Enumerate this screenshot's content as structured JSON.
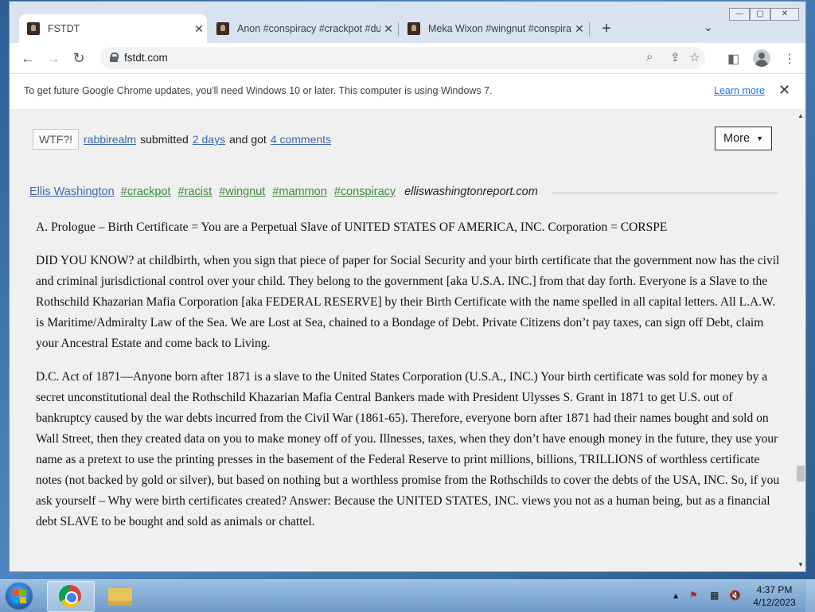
{
  "browser": {
    "tabs": [
      {
        "title": "FSTDT",
        "active": true
      },
      {
        "title": "Anon #conspiracy #crackpot #du",
        "active": false
      },
      {
        "title": "Meka Wixon #wingnut #conspira",
        "active": false
      }
    ],
    "new_tab_icon": "+",
    "tab_search_icon": "⌄",
    "window_controls": {
      "minimize": "—",
      "maximize": "▢",
      "close": "✕"
    },
    "url": "fstdt.com",
    "infobar": {
      "message": "To get future Google Chrome updates, you'll need Windows 10 or later. This computer is using Windows 7.",
      "learn_more": "Learn more",
      "close": "✕"
    }
  },
  "post_meta": {
    "badge": "WTF?!",
    "user": "rabbirealm",
    "submitted": "submitted",
    "time": "2 days",
    "and_got": "and got",
    "comments": "4 comments",
    "more_button": "More",
    "more_caret": "▼"
  },
  "quote": {
    "author": "Ellis Washington",
    "tags": [
      "#crackpot",
      "#racist",
      "#wingnut",
      "#mammon",
      "#conspiracy"
    ],
    "source": "elliswashingtonreport.com",
    "paragraphs": [
      "A. Prologue – Birth Certificate = You are a Perpetual Slave of UNITED STATES OF AMERICA, INC. Corporation = CORSPE",
      "DID YOU KNOW? at childbirth, when you sign that piece of paper for Social Security and your birth certificate that the government now has the civil and criminal jurisdictional control over your child. They belong to the government [aka U.S.A. INC.] from that day forth. Everyone is a Slave to the Rothschild Khazarian Mafia Corporation [aka FEDERAL RESERVE] by their Birth Certificate with the name spelled in all capital letters. All L.A.W. is Maritime/Admiralty Law of the Sea. We are Lost at Sea, chained to a Bondage of Debt. Private Citizens don’t pay taxes, can sign off Debt, claim your Ancestral Estate and come back to Living.",
      "D.C. Act of 1871—Anyone born after 1871 is a slave to the United States Corporation (U.S.A., INC.) Your birth certificate was sold for money by a secret unconstitutional deal the Rothschild Khazarian Mafia Central Bankers made with President Ulysses S. Grant in 1871 to get U.S. out of bankruptcy caused by the war debts incurred from the Civil War (1861-65). Therefore, everyone born after 1871 had their names bought and sold on Wall Street, then they created data on you to make money off of you. Illnesses, taxes, when they don’t have enough money in the future, they use your name as a pretext to use the printing presses in the basement of the Federal Reserve to print millions, billions, TRILLIONS of worthless certificate notes (not backed by gold or silver), but based on nothing but a worthless promise from the Rothschilds to cover the debts of the USA, INC. So, if you ask yourself – Why were birth certificates created? Answer: Because the UNITED STATES, INC. views you not as a human being, but as a financial debt SLAVE to be bought and sold as animals or chattel."
    ]
  },
  "taskbar": {
    "time": "4:37 PM",
    "date": "4/12/2023"
  },
  "colors": {
    "link": "#3b67b0",
    "tag": "#3a8a3a",
    "page_bg": "#f0f0f0"
  }
}
